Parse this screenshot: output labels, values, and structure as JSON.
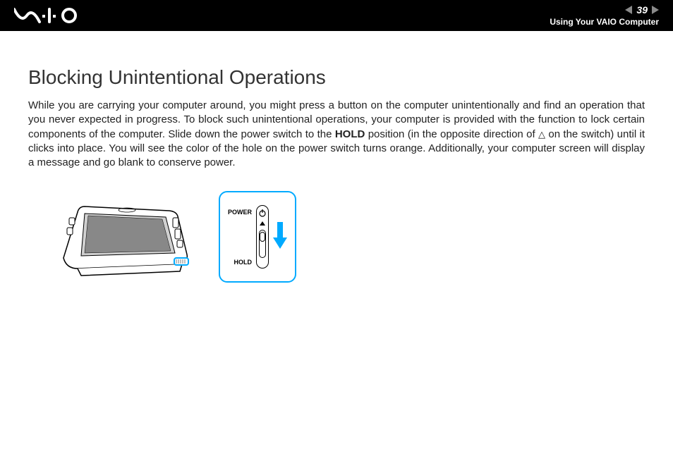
{
  "header": {
    "page_number": "39",
    "section": "Using Your VAIO Computer"
  },
  "content": {
    "title": "Blocking Unintentional Operations",
    "paragraph_part1": "While you are carrying your computer around, you might press a button on the computer unintentionally and find an operation that you never expected in progress. To block such unintentional operations, your computer is provided with the function to lock certain components of the computer. Slide down the power switch to the ",
    "hold_label": "HOLD",
    "paragraph_part2": " position (in the opposite direction of ",
    "triangle": "△",
    "paragraph_part3": " on the switch) until it clicks into place. You will see the color of the hole on the power switch turns orange. Additionally, your computer screen will display a message and go blank to conserve power."
  },
  "diagram": {
    "power_label": "POWER",
    "hold_label": "HOLD"
  }
}
